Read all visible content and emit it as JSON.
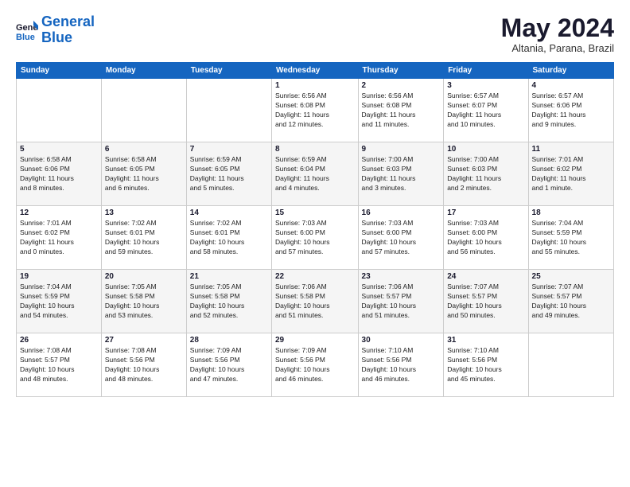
{
  "header": {
    "logo_line1": "General",
    "logo_line2": "Blue",
    "month": "May 2024",
    "location": "Altania, Parana, Brazil"
  },
  "days_of_week": [
    "Sunday",
    "Monday",
    "Tuesday",
    "Wednesday",
    "Thursday",
    "Friday",
    "Saturday"
  ],
  "weeks": [
    [
      {
        "num": "",
        "info": ""
      },
      {
        "num": "",
        "info": ""
      },
      {
        "num": "",
        "info": ""
      },
      {
        "num": "1",
        "info": "Sunrise: 6:56 AM\nSunset: 6:08 PM\nDaylight: 11 hours\nand 12 minutes."
      },
      {
        "num": "2",
        "info": "Sunrise: 6:56 AM\nSunset: 6:08 PM\nDaylight: 11 hours\nand 11 minutes."
      },
      {
        "num": "3",
        "info": "Sunrise: 6:57 AM\nSunset: 6:07 PM\nDaylight: 11 hours\nand 10 minutes."
      },
      {
        "num": "4",
        "info": "Sunrise: 6:57 AM\nSunset: 6:06 PM\nDaylight: 11 hours\nand 9 minutes."
      }
    ],
    [
      {
        "num": "5",
        "info": "Sunrise: 6:58 AM\nSunset: 6:06 PM\nDaylight: 11 hours\nand 8 minutes."
      },
      {
        "num": "6",
        "info": "Sunrise: 6:58 AM\nSunset: 6:05 PM\nDaylight: 11 hours\nand 6 minutes."
      },
      {
        "num": "7",
        "info": "Sunrise: 6:59 AM\nSunset: 6:05 PM\nDaylight: 11 hours\nand 5 minutes."
      },
      {
        "num": "8",
        "info": "Sunrise: 6:59 AM\nSunset: 6:04 PM\nDaylight: 11 hours\nand 4 minutes."
      },
      {
        "num": "9",
        "info": "Sunrise: 7:00 AM\nSunset: 6:03 PM\nDaylight: 11 hours\nand 3 minutes."
      },
      {
        "num": "10",
        "info": "Sunrise: 7:00 AM\nSunset: 6:03 PM\nDaylight: 11 hours\nand 2 minutes."
      },
      {
        "num": "11",
        "info": "Sunrise: 7:01 AM\nSunset: 6:02 PM\nDaylight: 11 hours\nand 1 minute."
      }
    ],
    [
      {
        "num": "12",
        "info": "Sunrise: 7:01 AM\nSunset: 6:02 PM\nDaylight: 11 hours\nand 0 minutes."
      },
      {
        "num": "13",
        "info": "Sunrise: 7:02 AM\nSunset: 6:01 PM\nDaylight: 10 hours\nand 59 minutes."
      },
      {
        "num": "14",
        "info": "Sunrise: 7:02 AM\nSunset: 6:01 PM\nDaylight: 10 hours\nand 58 minutes."
      },
      {
        "num": "15",
        "info": "Sunrise: 7:03 AM\nSunset: 6:00 PM\nDaylight: 10 hours\nand 57 minutes."
      },
      {
        "num": "16",
        "info": "Sunrise: 7:03 AM\nSunset: 6:00 PM\nDaylight: 10 hours\nand 57 minutes."
      },
      {
        "num": "17",
        "info": "Sunrise: 7:03 AM\nSunset: 6:00 PM\nDaylight: 10 hours\nand 56 minutes."
      },
      {
        "num": "18",
        "info": "Sunrise: 7:04 AM\nSunset: 5:59 PM\nDaylight: 10 hours\nand 55 minutes."
      }
    ],
    [
      {
        "num": "19",
        "info": "Sunrise: 7:04 AM\nSunset: 5:59 PM\nDaylight: 10 hours\nand 54 minutes."
      },
      {
        "num": "20",
        "info": "Sunrise: 7:05 AM\nSunset: 5:58 PM\nDaylight: 10 hours\nand 53 minutes."
      },
      {
        "num": "21",
        "info": "Sunrise: 7:05 AM\nSunset: 5:58 PM\nDaylight: 10 hours\nand 52 minutes."
      },
      {
        "num": "22",
        "info": "Sunrise: 7:06 AM\nSunset: 5:58 PM\nDaylight: 10 hours\nand 51 minutes."
      },
      {
        "num": "23",
        "info": "Sunrise: 7:06 AM\nSunset: 5:57 PM\nDaylight: 10 hours\nand 51 minutes."
      },
      {
        "num": "24",
        "info": "Sunrise: 7:07 AM\nSunset: 5:57 PM\nDaylight: 10 hours\nand 50 minutes."
      },
      {
        "num": "25",
        "info": "Sunrise: 7:07 AM\nSunset: 5:57 PM\nDaylight: 10 hours\nand 49 minutes."
      }
    ],
    [
      {
        "num": "26",
        "info": "Sunrise: 7:08 AM\nSunset: 5:57 PM\nDaylight: 10 hours\nand 48 minutes."
      },
      {
        "num": "27",
        "info": "Sunrise: 7:08 AM\nSunset: 5:56 PM\nDaylight: 10 hours\nand 48 minutes."
      },
      {
        "num": "28",
        "info": "Sunrise: 7:09 AM\nSunset: 5:56 PM\nDaylight: 10 hours\nand 47 minutes."
      },
      {
        "num": "29",
        "info": "Sunrise: 7:09 AM\nSunset: 5:56 PM\nDaylight: 10 hours\nand 46 minutes."
      },
      {
        "num": "30",
        "info": "Sunrise: 7:10 AM\nSunset: 5:56 PM\nDaylight: 10 hours\nand 46 minutes."
      },
      {
        "num": "31",
        "info": "Sunrise: 7:10 AM\nSunset: 5:56 PM\nDaylight: 10 hours\nand 45 minutes."
      },
      {
        "num": "",
        "info": ""
      }
    ]
  ]
}
